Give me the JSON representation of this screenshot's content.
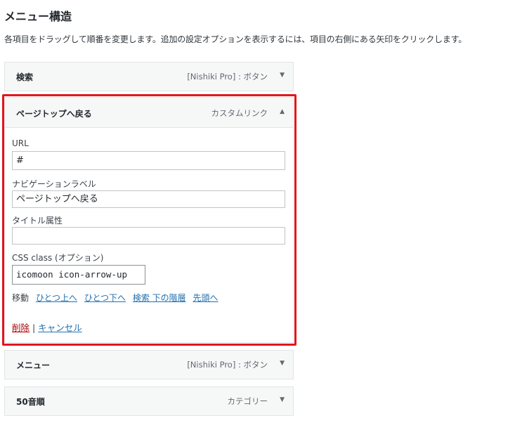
{
  "page": {
    "title": "メニュー構造",
    "description": "各項目をドラッグして順番を変更します。追加の設定オプションを表示するには、項目の右側にある矢印をクリックします。"
  },
  "menu_items": [
    {
      "title": "検索",
      "type": "[Nishiki Pro] : ボタン",
      "arrow": "▼"
    },
    {
      "title": "ページトップへ戻る",
      "type": "カスタムリンク",
      "arrow": "▲"
    },
    {
      "title": "メニュー",
      "type": "[Nishiki Pro] : ボタン",
      "arrow": "▼"
    },
    {
      "title": "50音順",
      "type": "カテゴリー",
      "arrow": "▼"
    }
  ],
  "edit_panel": {
    "url_label": "URL",
    "url_value": "#",
    "nav_label_label": "ナビゲーションラベル",
    "nav_label_value": "ページトップへ戻る",
    "title_attr_label": "タイトル属性",
    "title_attr_value": "",
    "css_class_label": "CSS class (オプション)",
    "css_class_value": "icomoon icon-arrow-up",
    "move_label": "移動",
    "move_links": [
      "ひとつ上へ",
      "ひとつ下へ",
      "検索 下の階層",
      "先頭へ"
    ],
    "delete_label": "削除",
    "separator": "|",
    "cancel_label": "キャンセル"
  },
  "colors": {
    "highlight": "#e2161d",
    "link": "#2271b1",
    "delete": "#aa0000"
  }
}
